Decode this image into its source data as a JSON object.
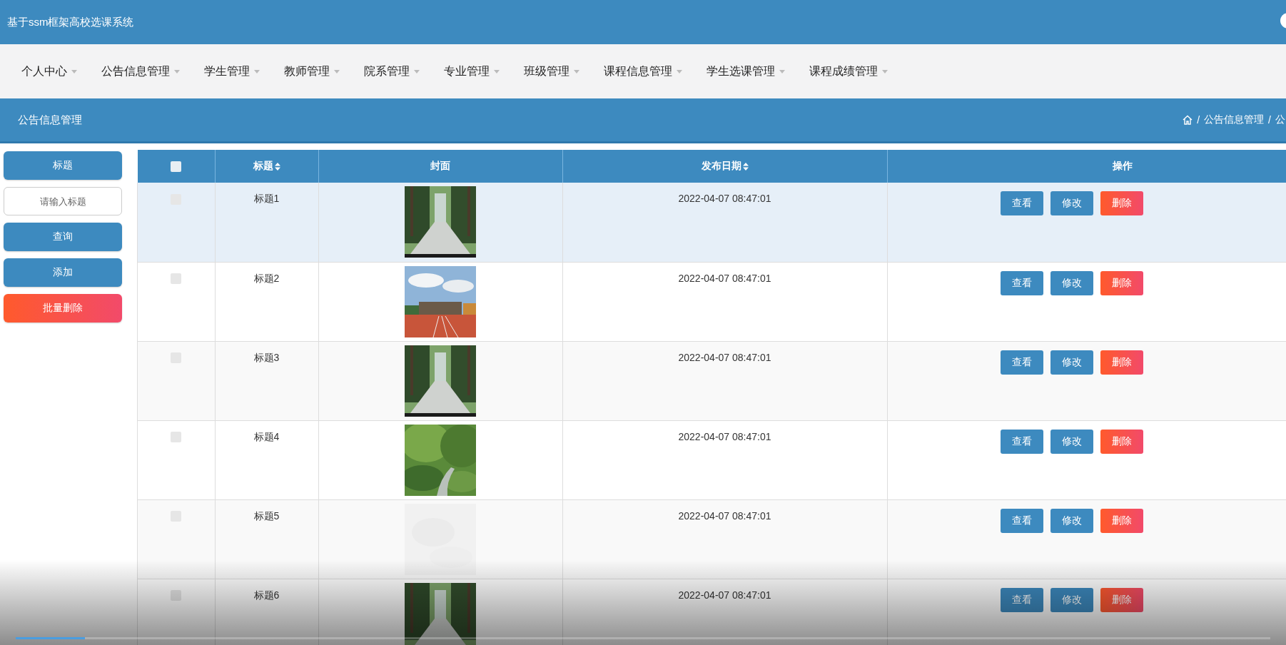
{
  "header": {
    "title": "基于ssm框架高校选课系统"
  },
  "nav": {
    "items": [
      {
        "label": "个人中心",
        "selected": false
      },
      {
        "label": "公告信息管理",
        "selected": false
      },
      {
        "label": "学生管理",
        "selected": false
      },
      {
        "label": "教师管理",
        "selected": false
      },
      {
        "label": "院系管理",
        "selected": false
      },
      {
        "label": "专业管理",
        "selected": false
      },
      {
        "label": "班级管理",
        "selected": false
      },
      {
        "label": "课程信息管理",
        "selected": false
      },
      {
        "label": "学生选课管理",
        "selected": false
      },
      {
        "label": "课程成绩管理",
        "selected": false
      }
    ]
  },
  "page_bar": {
    "title": "公告信息管理",
    "breadcrumb": [
      {
        "separator": "/",
        "label": "公告信息管理"
      },
      {
        "separator": "/",
        "label": "公"
      }
    ]
  },
  "sidebar": {
    "field_label": "标题",
    "search": {
      "placeholder": "请输入标题"
    },
    "buttons": [
      {
        "label": "查询",
        "kind": "primary"
      },
      {
        "label": "添加",
        "kind": "primary"
      },
      {
        "label": "批量删除",
        "kind": "danger"
      }
    ]
  },
  "table": {
    "columns": [
      {
        "kind": "checkbox",
        "sortable": false
      },
      {
        "label": "标题",
        "kind": "text",
        "sortable": true
      },
      {
        "label": "封面",
        "kind": "text",
        "sortable": false
      },
      {
        "label": "发布日期",
        "kind": "text",
        "sortable": true
      },
      {
        "label": "操作",
        "kind": "text",
        "sortable": false
      }
    ],
    "header_checked": false,
    "rows": [
      {
        "checked": false,
        "highlighted": true,
        "title": "标题1",
        "date": "2022-04-07 08:47:01",
        "actions": [
          "查看",
          "修改",
          "删除"
        ]
      },
      {
        "checked": false,
        "highlighted": false,
        "title": "标题2",
        "date": "2022-04-07 08:47:01",
        "actions": [
          "查看",
          "修改",
          "删除"
        ]
      },
      {
        "checked": false,
        "highlighted": false,
        "title": "标题3",
        "date": "2022-04-07 08:47:01",
        "actions": [
          "查看",
          "修改",
          "删除"
        ]
      },
      {
        "checked": false,
        "highlighted": false,
        "title": "标题4",
        "date": "2022-04-07 08:47:01",
        "actions": [
          "查看",
          "修改",
          "删除"
        ]
      },
      {
        "checked": false,
        "highlighted": false,
        "title": "标题5",
        "cover": {
          "kind": "faint-picture"
        },
        "date": "2022-04-07 08:47:01",
        "actions": [
          "查看",
          "修改",
          "删除"
        ]
      },
      {
        "checked": false,
        "highlighted": false,
        "title": "标题6",
        "date": "2022-04-07 08:47:01",
        "actions": [
          "查看",
          "修改",
          "删除"
        ]
      }
    ]
  },
  "video_progress": {
    "level": 0.055
  }
}
